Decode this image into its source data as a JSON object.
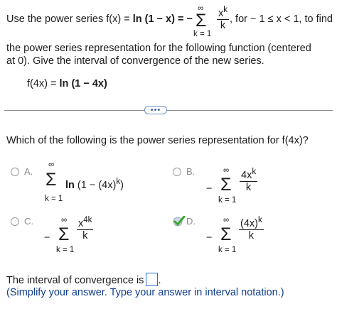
{
  "intro": {
    "line1_prefix": "Use the power series f(x) = ",
    "line1_fn": "ln (1 − x) = −",
    "sum_top": "∞",
    "sum_bottom": "k = 1",
    "frac_num": "x",
    "frac_num_sup": "k",
    "frac_den": "k",
    "line1_suffix": ", for  − 1 ≤ x < 1, to find",
    "line2": "the power series representation for the following function (centered",
    "line3": "at 0). Give the interval of convergence of the new series.",
    "function_prefix": "f(4x) = ",
    "function_body": "ln (1 − 4x)"
  },
  "expand_button": {
    "label": "•••"
  },
  "question": {
    "text": "Which of the following is the power series representation for f(4x)?"
  },
  "options": {
    "A": {
      "label": "A.",
      "sum_top": "∞",
      "sum_bottom": "k = 1",
      "term_ln": "ln",
      "term_open": "(1 − (4x)",
      "term_sup": "k",
      "term_close": ")"
    },
    "B": {
      "label": "B.",
      "minus": "−",
      "sum_top": "∞",
      "sum_bottom": "k = 1",
      "num": "4x",
      "num_sup": "k",
      "den": "k"
    },
    "C": {
      "label": "C.",
      "minus": "−",
      "sum_top": "∞",
      "sum_bottom": "k = 1",
      "num": "x",
      "num_sup": "4k",
      "den": "k"
    },
    "D": {
      "label": "D.",
      "minus": "−",
      "sum_top": "∞",
      "sum_bottom": "k = 1",
      "num": "(4x)",
      "num_sup": "k",
      "den": "k",
      "selected": true
    }
  },
  "interval": {
    "prompt": "The interval of convergence is",
    "after_box": ".",
    "hint": "(Simplify your answer. Type your answer in interval notation.)",
    "value": ""
  },
  "colors": {
    "accent_blue": "#2a6fd6",
    "check_green": "#3aa535",
    "hint_blue": "#0f3e8f"
  }
}
